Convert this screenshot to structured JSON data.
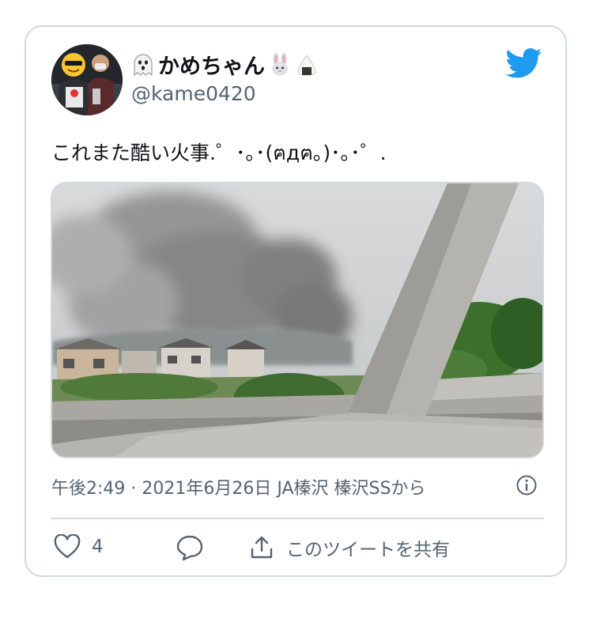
{
  "tweet": {
    "display_name": "かめちゃん",
    "handle": "@kame0420",
    "text": "これまた酷い火事.゜･｡･(ฅдฅ｡)･｡･゜.",
    "meta": "午後2:49 · 2021年6月26日 JA榛沢 榛沢SSから",
    "icons": {
      "name_prefix": "ghost-emoji-icon",
      "name_suffix_1": "rabbit-emoji-icon",
      "name_suffix_2": "rice-ball-emoji-icon",
      "brand": "twitter-bird-icon",
      "info": "info-icon"
    }
  },
  "actions": {
    "like_count": "4",
    "share_label": "このツイートを共有"
  },
  "colors": {
    "twitter_blue": "#1d9bf0",
    "secondary_text": "#536471",
    "border": "#cfd9de"
  }
}
